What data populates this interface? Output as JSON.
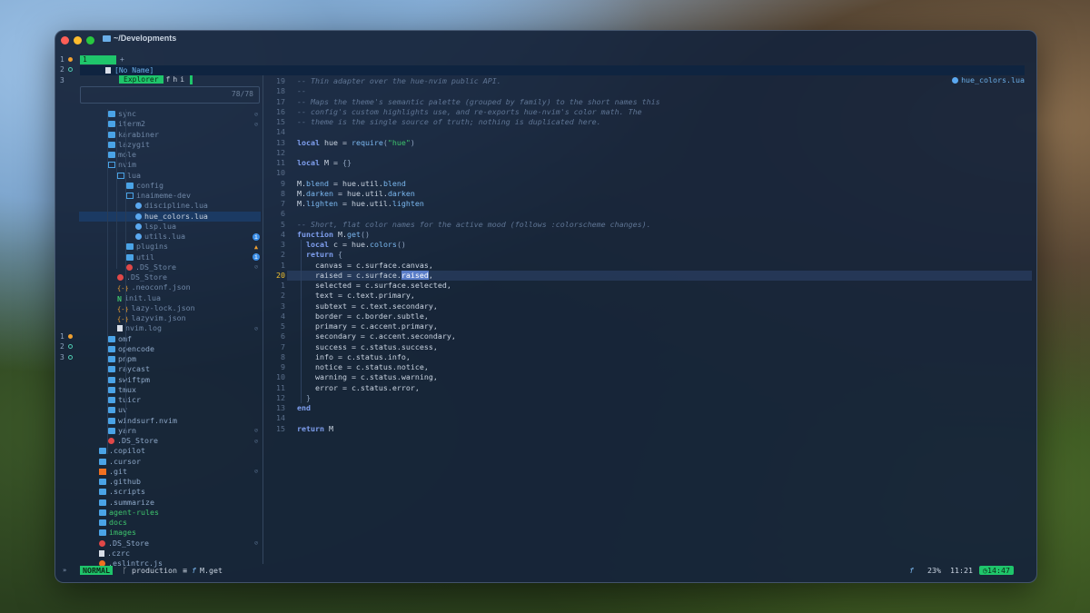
{
  "window": {
    "title": "~/Developments"
  },
  "tabline": {
    "active_tab": "1",
    "new_tab": "+"
  },
  "left_gutter": [
    {
      "num": "1",
      "marker": "mod"
    },
    {
      "num": "2",
      "marker": "unmod"
    },
    {
      "num": "3",
      "marker": ""
    }
  ],
  "left_gutter_bottom": [
    {
      "num": "1",
      "marker": "mod"
    },
    {
      "num": "2",
      "marker": "unmod"
    },
    {
      "num": "3",
      "marker": "unmod"
    }
  ],
  "buffer_row": {
    "name": "[No Name]"
  },
  "sidebar": {
    "header": {
      "explorer": "Explorer",
      "tabs": [
        "f",
        "h",
        "i"
      ]
    },
    "search_count": "78/78",
    "tree": [
      {
        "label": "sync",
        "icon": "folder",
        "depth": 3,
        "color": "dim",
        "status": "eye"
      },
      {
        "label": "iterm2",
        "icon": "folder",
        "depth": 3,
        "color": "dim",
        "status": "eye"
      },
      {
        "label": "karabiner",
        "icon": "folder",
        "depth": 3,
        "color": "dim"
      },
      {
        "label": "lazygit",
        "icon": "folder",
        "depth": 3,
        "color": "dim"
      },
      {
        "label": "mole",
        "icon": "folder",
        "depth": 3,
        "color": "dim"
      },
      {
        "label": "nvim",
        "icon": "folder-open",
        "depth": 3,
        "color": "dim"
      },
      {
        "label": "lua",
        "icon": "folder-open",
        "depth": 4,
        "color": "dim"
      },
      {
        "label": "config",
        "icon": "folder",
        "depth": 5,
        "color": "dim"
      },
      {
        "label": "inaimeme-dev",
        "icon": "folder-open",
        "depth": 5,
        "color": "dim"
      },
      {
        "label": "discipline.lua",
        "icon": "lua",
        "depth": 6,
        "color": "dim"
      },
      {
        "label": "hue_colors.lua",
        "icon": "lua",
        "depth": 6,
        "color": "sel",
        "selected": true
      },
      {
        "label": "lsp.lua",
        "icon": "lua",
        "depth": 6,
        "color": "dim"
      },
      {
        "label": "utils.lua",
        "icon": "lua",
        "depth": 6,
        "color": "dim",
        "status": "info"
      },
      {
        "label": "plugins",
        "icon": "folder",
        "depth": 5,
        "color": "dim",
        "status": "warn"
      },
      {
        "label": "util",
        "icon": "folder",
        "depth": 5,
        "color": "dim",
        "status": "info"
      },
      {
        "label": ".DS_Store",
        "icon": "gear",
        "depth": 5,
        "color": "dim",
        "status": "eye"
      },
      {
        "label": ".DS_Store",
        "icon": "gear",
        "depth": 4,
        "color": "dim"
      },
      {
        "label": ".neoconf.json",
        "icon": "json",
        "depth": 4,
        "color": "dim"
      },
      {
        "label": "init.lua",
        "icon": "nvim",
        "depth": 4,
        "color": "dim"
      },
      {
        "label": "lazy-lock.json",
        "icon": "json",
        "depth": 4,
        "color": "dim"
      },
      {
        "label": "lazyvim.json",
        "icon": "json",
        "depth": 4,
        "color": "dim"
      },
      {
        "label": "nvim.log",
        "icon": "file",
        "depth": 4,
        "color": "dim",
        "status": "eye"
      },
      {
        "label": "omf",
        "icon": "folder",
        "depth": 3,
        "color": "norm"
      },
      {
        "label": "opencode",
        "icon": "folder",
        "depth": 3,
        "color": "norm"
      },
      {
        "label": "pnpm",
        "icon": "folder",
        "depth": 3,
        "color": "norm"
      },
      {
        "label": "raycast",
        "icon": "folder",
        "depth": 3,
        "color": "norm"
      },
      {
        "label": "swiftpm",
        "icon": "folder",
        "depth": 3,
        "color": "norm"
      },
      {
        "label": "tmux",
        "icon": "folder",
        "depth": 3,
        "color": "norm"
      },
      {
        "label": "tuicr",
        "icon": "folder",
        "depth": 3,
        "color": "norm"
      },
      {
        "label": "uv",
        "icon": "folder",
        "depth": 3,
        "color": "norm"
      },
      {
        "label": "windsurf.nvim",
        "icon": "folder",
        "depth": 3,
        "color": "norm"
      },
      {
        "label": "yarn",
        "icon": "folder",
        "depth": 3,
        "color": "norm",
        "status": "eye"
      },
      {
        "label": ".DS_Store",
        "icon": "gear",
        "depth": 3,
        "color": "norm",
        "status": "eye"
      },
      {
        "label": ".copilot",
        "icon": "folder",
        "depth": 2,
        "color": "norm"
      },
      {
        "label": ".cursor",
        "icon": "folder",
        "depth": 2,
        "color": "norm"
      },
      {
        "label": ".git",
        "icon": "gitf",
        "depth": 2,
        "color": "norm",
        "status": "eye"
      },
      {
        "label": ".github",
        "icon": "folder",
        "depth": 2,
        "color": "norm"
      },
      {
        "label": ".scripts",
        "icon": "folder",
        "depth": 2,
        "color": "norm"
      },
      {
        "label": ".summarize",
        "icon": "folder",
        "depth": 2,
        "color": "norm"
      },
      {
        "label": "agent-rules",
        "icon": "folder",
        "depth": 2,
        "color": "green"
      },
      {
        "label": "docs",
        "icon": "folder",
        "depth": 2,
        "color": "green"
      },
      {
        "label": "images",
        "icon": "folder",
        "depth": 2,
        "color": "green"
      },
      {
        "label": ".DS_Store",
        "icon": "gear",
        "depth": 2,
        "color": "norm",
        "status": "eye"
      },
      {
        "label": ".czrc",
        "icon": "file",
        "depth": 2,
        "color": "norm"
      },
      {
        "label": ".eslintrc.js",
        "icon": "eslint",
        "depth": 2,
        "color": "norm"
      }
    ]
  },
  "editor": {
    "winbar_file": "hue_colors.lua",
    "current_line_index": 18,
    "lines": [
      {
        "n": "19",
        "html": "<span class='cm'>-- Thin adapter over the hue-nvim public API.</span>"
      },
      {
        "n": "18",
        "html": "<span class='cm'>--</span>"
      },
      {
        "n": "17",
        "html": "<span class='cm'>-- Maps the theme's semantic palette (grouped by family) to the short names this</span>"
      },
      {
        "n": "16",
        "html": "<span class='cm'>-- config's custom highlights use, and re-exports hue-nvim's color math. The</span>"
      },
      {
        "n": "15",
        "html": "<span class='cm'>-- theme is the single source of truth; nothing is duplicated here.</span>"
      },
      {
        "n": "14",
        "html": ""
      },
      {
        "n": "13",
        "html": "<span class='kw'>local</span> hue = <span class='fn'>require</span><span class='br'>(</span><span class='str'>\"hue\"</span><span class='br'>)</span>"
      },
      {
        "n": "12",
        "html": ""
      },
      {
        "n": "11",
        "html": "<span class='kw'>local</span> M = <span class='br'>{}</span>"
      },
      {
        "n": "10",
        "html": ""
      },
      {
        "n": "9",
        "html": "M.<span class='pr'>blend</span> = hue.util.<span class='pr'>blend</span>"
      },
      {
        "n": "8",
        "html": "M.<span class='pr'>darken</span> = hue.util.<span class='pr'>darken</span>"
      },
      {
        "n": "7",
        "html": "M.<span class='pr'>lighten</span> = hue.util.<span class='pr'>lighten</span>"
      },
      {
        "n": "6",
        "html": ""
      },
      {
        "n": "5",
        "html": "<span class='cm'>-- Short, flat color names for the active mood (follows :colorscheme changes).</span>"
      },
      {
        "n": "4",
        "html": "<span class='kw'>function</span> M.<span class='fn'>get</span><span class='br'>()</span>"
      },
      {
        "n": "3",
        "html": "  <span class='kw'>local</span> c = hue.<span class='fn'>colors</span><span class='br'>()</span>"
      },
      {
        "n": "2",
        "html": "  <span class='kw'>return</span> <span class='br'>{</span>"
      },
      {
        "n": "1",
        "html": "    canvas = c.surface.canvas,"
      },
      {
        "n": "20",
        "html": "    raised = c.surface.<span class='cursor-blk'>raised</span>,"
      },
      {
        "n": "1",
        "html": "    selected = c.surface.selected,"
      },
      {
        "n": "2",
        "html": "    text = c.text.primary,"
      },
      {
        "n": "3",
        "html": "    subtext = c.text.secondary,"
      },
      {
        "n": "4",
        "html": "    border = c.border.subtle,"
      },
      {
        "n": "5",
        "html": "    primary = c.accent.primary,"
      },
      {
        "n": "6",
        "html": "    secondary = c.accent.secondary,"
      },
      {
        "n": "7",
        "html": "    success = c.status.success,"
      },
      {
        "n": "8",
        "html": "    info = c.status.info,"
      },
      {
        "n": "9",
        "html": "    notice = c.status.notice,"
      },
      {
        "n": "10",
        "html": "    warning = c.status.warning,"
      },
      {
        "n": "11",
        "html": "    error = c.status.error,"
      },
      {
        "n": "12",
        "html": "  <span class='br'>}</span>"
      },
      {
        "n": "13",
        "html": "<span class='kw'>end</span>"
      },
      {
        "n": "14",
        "html": ""
      },
      {
        "n": "15",
        "html": "<span class='kw'>return</span> M"
      }
    ]
  },
  "statusline": {
    "left_glyph": "»",
    "mode": "NORMAL",
    "branch": "production",
    "list_icon": "≡",
    "symbol_prefix": "f",
    "symbol": "M.get",
    "right_f": "f",
    "percent": "23%",
    "position": "11:21",
    "time": "14:47"
  },
  "colors": {
    "accent": "#1fc56b",
    "bg": "#16243a"
  }
}
